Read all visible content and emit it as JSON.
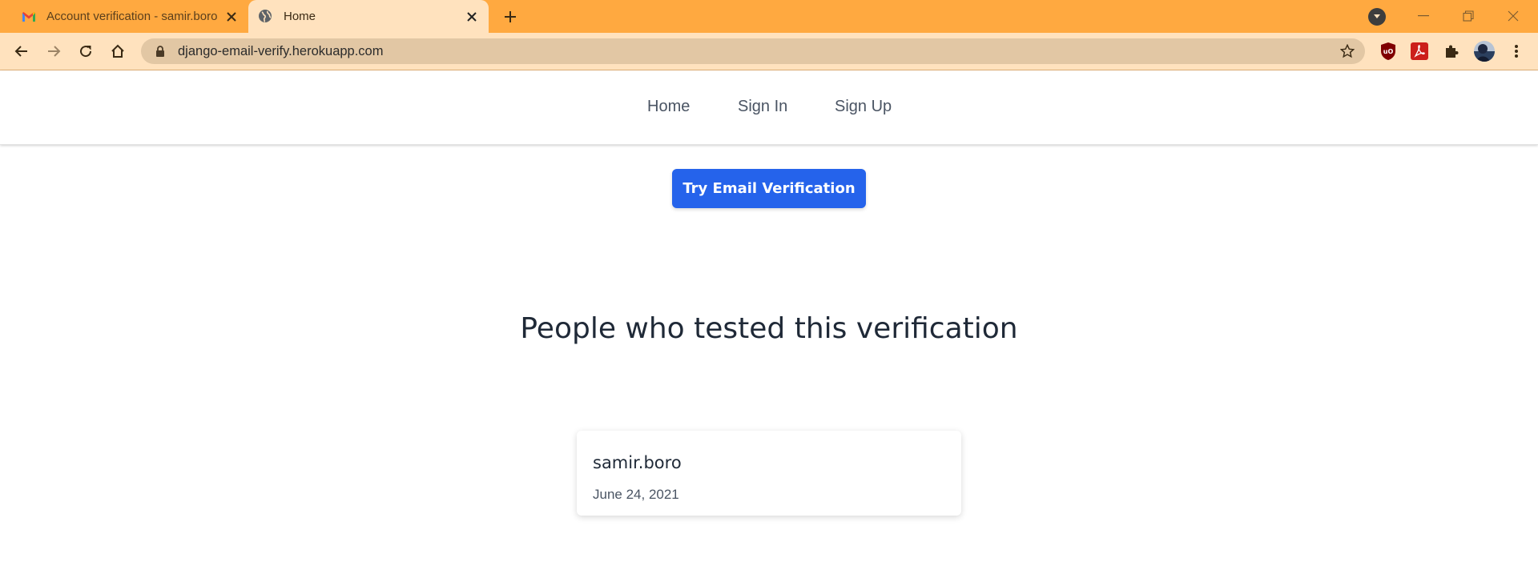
{
  "browser": {
    "tabs": [
      {
        "title": "Account verification - samir.boro",
        "favicon": "gmail-icon",
        "active": false
      },
      {
        "title": "Home",
        "favicon": "globe-icon",
        "active": true
      }
    ],
    "url": "django-email-verify.herokuapp.com",
    "colors": {
      "tabstrip": "#ffa940",
      "toolbar": "#ffe2be",
      "omnibox": "#e2c7a4"
    }
  },
  "nav": {
    "links": [
      {
        "label": "Home"
      },
      {
        "label": "Sign In"
      },
      {
        "label": "Sign Up"
      }
    ]
  },
  "main": {
    "cta_label": "Try Email Verification",
    "heading": "People who tested this verification",
    "testers": [
      {
        "username": "samir.boro",
        "date": "June 24, 2021"
      }
    ]
  },
  "colors": {
    "primary": "#2563eb",
    "text": "#1f2937",
    "muted": "#4a5463"
  }
}
